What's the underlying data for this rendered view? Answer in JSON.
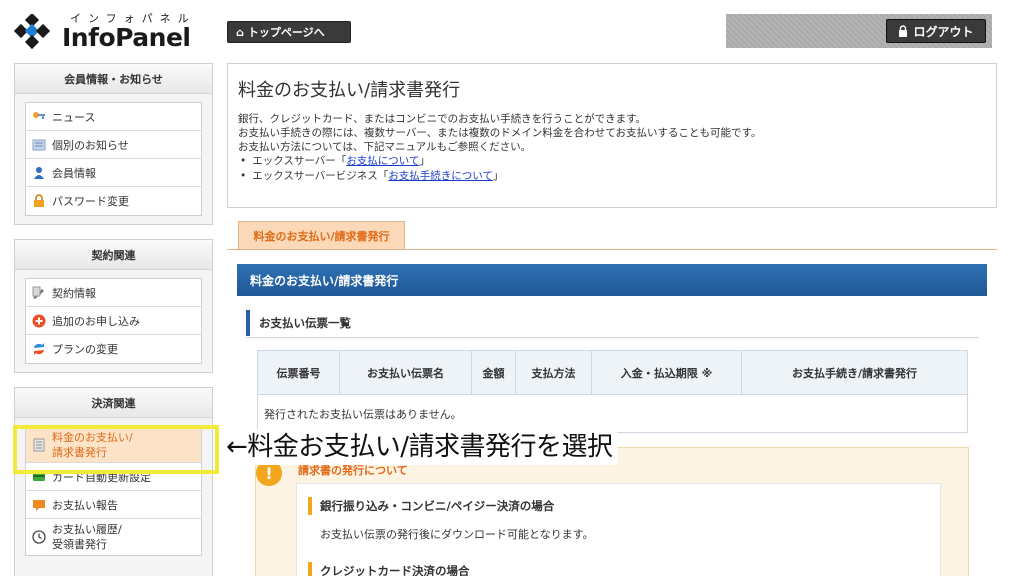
{
  "header": {
    "logo_kana": "インフォパネル",
    "logo_text": "InfoPanel",
    "top_page_label": "トップページへ",
    "logout_label": "ログアウト"
  },
  "sidebar": {
    "sections": [
      {
        "title": "会員情報・お知らせ",
        "items": [
          {
            "label": "ニュース",
            "icon": "key-person-icon"
          },
          {
            "label": "個別のお知らせ",
            "icon": "message-icon"
          },
          {
            "label": "会員情報",
            "icon": "user-icon"
          },
          {
            "label": "パスワード変更",
            "icon": "lock-icon"
          }
        ]
      },
      {
        "title": "契約関連",
        "items": [
          {
            "label": "契約情報",
            "icon": "contract-icon"
          },
          {
            "label": "追加のお申し込み",
            "icon": "plus-circle-icon"
          },
          {
            "label": "プランの変更",
            "icon": "swap-icon"
          }
        ]
      },
      {
        "title": "決済関連",
        "items": [
          {
            "label_line1": "料金のお支払い/",
            "label_line2": "請求書発行",
            "icon": "invoice-icon"
          },
          {
            "label": "カード自動更新設定",
            "icon": "credit-card-icon"
          },
          {
            "label": "お支払い報告",
            "icon": "report-icon"
          },
          {
            "label_line1": "お支払い履歴/",
            "label_line2": "受領書発行",
            "icon": "clock-icon"
          }
        ]
      }
    ]
  },
  "intro": {
    "title": "料金のお支払い/請求書発行",
    "line1": "銀行、クレジットカード、またはコンビニでのお支払い手続きを行うことができます。",
    "line2": "お支払い手続きの際には、複数サーバー、または複数のドメイン料金を合わせてお支払いすることも可能です。",
    "line3": "お支払い方法については、下記マニュアルもご参照ください。",
    "bullet1_prefix": "エックスサーバー「",
    "bullet1_link": "お支払について",
    "bullet1_suffix": "」",
    "bullet2_prefix": "エックスサーバービジネス「",
    "bullet2_link": "お支払手続きについて",
    "bullet2_suffix": "」"
  },
  "tab": {
    "label": "料金のお支払い/請求書発行"
  },
  "section": {
    "bar_title": "料金のお支払い/請求書発行",
    "list_title": "お支払い伝票一覧"
  },
  "table": {
    "headers": [
      "伝票番号",
      "お支払い伝票名",
      "金額",
      "支払方法",
      "入金・払込期限 ※",
      "お支払手続き/請求書発行"
    ],
    "empty_message": "発行されたお支払い伝票はありません。"
  },
  "info": {
    "title": "請求書の発行について",
    "sec1_title": "銀行振り込み・コンビニ/ペイジー決済の場合",
    "sec1_text": "お支払い伝票の発行後にダウンロード可能となります。",
    "sec2_title": "クレジットカード決済の場合"
  },
  "annotation": {
    "text": "←料金お支払い/請求書発行を選択",
    "highlight_color": "#f2ea38"
  },
  "colors": {
    "accent_orange": "#e06a16",
    "bar_blue": "#1f5797",
    "link_blue": "#1a3ccc"
  }
}
